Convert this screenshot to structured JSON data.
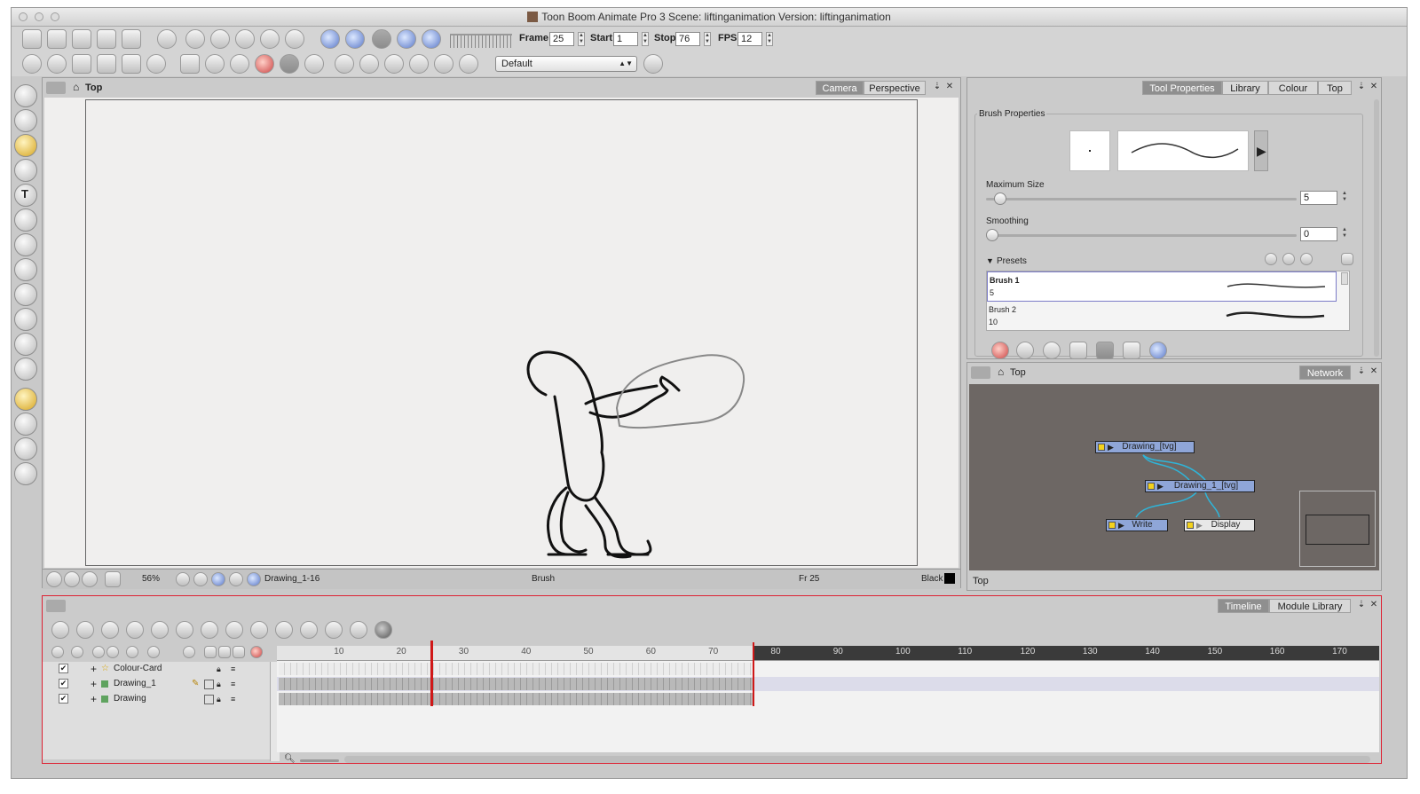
{
  "window": {
    "title": "Toon Boom Animate Pro 3 Scene: liftinganimation Version: liftinganimation"
  },
  "toolbar": {
    "frame_label": "Frame",
    "frame_value": "25",
    "start_label": "Start",
    "start_value": "1",
    "stop_label": "Stop",
    "stop_value": "76",
    "fps_label": "FPS",
    "fps_value": "12",
    "workspace_value": "Default"
  },
  "viewer": {
    "breadcrumb": "Top",
    "tabs": [
      "Camera",
      "Perspective"
    ],
    "status": {
      "zoom": "56%",
      "drawing": "Drawing_1-16",
      "tool": "Brush",
      "frame": "Fr 25",
      "colour": "Black"
    }
  },
  "tool_properties": {
    "tabs": [
      "Tool Properties",
      "Library",
      "Colour",
      "Top"
    ],
    "section_title": "Brush Properties",
    "max_size_label": "Maximum Size",
    "max_size_value": "5",
    "max_size_level": 0.01,
    "smoothing_label": "Smoothing",
    "smoothing_value": "0",
    "smoothing_level": 0,
    "presets_label": "Presets",
    "presets": [
      {
        "name": "Brush 1",
        "size": "5"
      },
      {
        "name": "Brush 2",
        "size": "10"
      }
    ]
  },
  "network": {
    "breadcrumb": "Top",
    "tab": "Network",
    "nodes": [
      "Drawing_[tvg]",
      "Drawing_1_[tvg]",
      "Write",
      "Display"
    ],
    "footer": "Top"
  },
  "timeline": {
    "tabs": [
      "Timeline",
      "Module Library"
    ],
    "layers": [
      "Colour-Card",
      "Drawing_1",
      "Drawing"
    ],
    "ruler_labels": [
      "10",
      "20",
      "30",
      "40",
      "50",
      "60",
      "70",
      "80",
      "90",
      "100",
      "110",
      "120",
      "130",
      "140",
      "150",
      "160",
      "170"
    ],
    "current_frame": 25,
    "stop_frame": 76,
    "colors": {
      "accent": "#d01818",
      "panel": "#cbcbcb",
      "network_bg": "#6d6764"
    }
  }
}
